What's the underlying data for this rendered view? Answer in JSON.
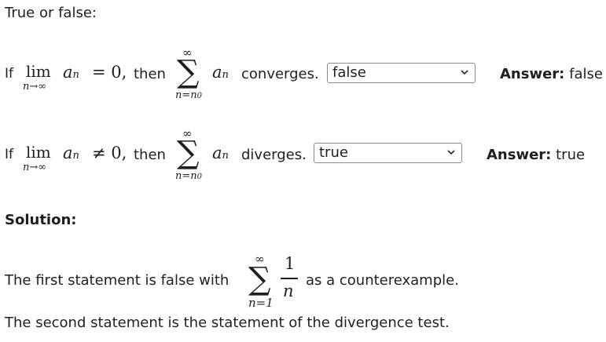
{
  "prompt": "True or false:",
  "q1": {
    "if": "If",
    "lim": "lim",
    "lim_sub": "n→∞",
    "a": "a",
    "n": "n",
    "rel": "= 0,",
    "then": "then",
    "sum_sup": "∞",
    "sigma": "∑",
    "sum_sub": "n=n",
    "sum_sub0": "0",
    "after": "converges.",
    "selected": "false",
    "answer_label": "Answer:",
    "answer_value": "false"
  },
  "q2": {
    "if": "If",
    "lim": "lim",
    "lim_sub": "n→∞",
    "a": "a",
    "n": "n",
    "rel": "≠ 0,",
    "then": "then",
    "sum_sup": "∞",
    "sigma": "∑",
    "sum_sub": "n=n",
    "sum_sub0": "0",
    "after": "diverges.",
    "selected": "true",
    "answer_label": "Answer:",
    "answer_value": "true"
  },
  "solution": {
    "heading": "Solution:",
    "line1_before": "The first statement is false with",
    "sum_sup": "∞",
    "sigma": "∑",
    "sum_sub": "n=1",
    "numerator": "1",
    "denominator": "n",
    "line1_after": "as a counterexample.",
    "line2": "The second statement is the statement of the divergence test."
  },
  "icons": {
    "dropdown": "chevron-down-icon"
  }
}
